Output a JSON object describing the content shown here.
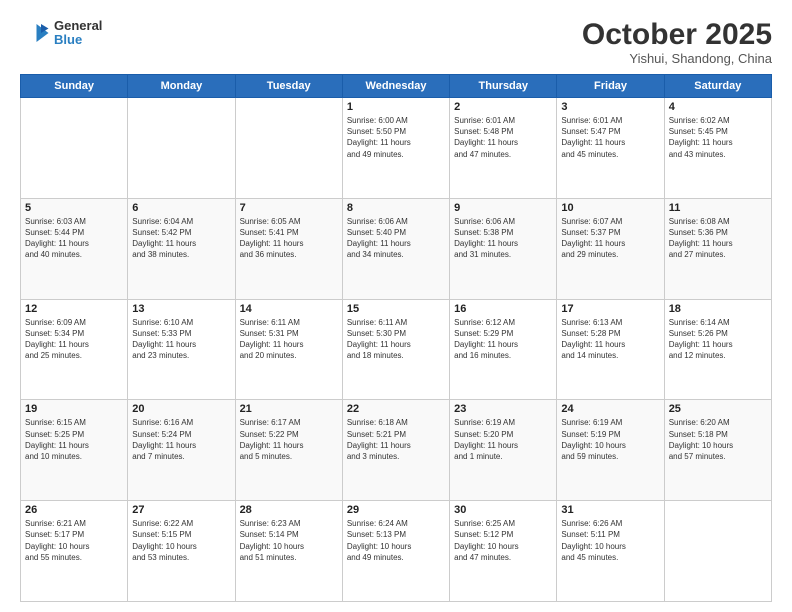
{
  "header": {
    "logo_line1": "General",
    "logo_line2": "Blue",
    "month": "October 2025",
    "location": "Yishui, Shandong, China"
  },
  "days_of_week": [
    "Sunday",
    "Monday",
    "Tuesday",
    "Wednesday",
    "Thursday",
    "Friday",
    "Saturday"
  ],
  "weeks": [
    [
      {
        "day": "",
        "info": ""
      },
      {
        "day": "",
        "info": ""
      },
      {
        "day": "",
        "info": ""
      },
      {
        "day": "1",
        "info": "Sunrise: 6:00 AM\nSunset: 5:50 PM\nDaylight: 11 hours\nand 49 minutes."
      },
      {
        "day": "2",
        "info": "Sunrise: 6:01 AM\nSunset: 5:48 PM\nDaylight: 11 hours\nand 47 minutes."
      },
      {
        "day": "3",
        "info": "Sunrise: 6:01 AM\nSunset: 5:47 PM\nDaylight: 11 hours\nand 45 minutes."
      },
      {
        "day": "4",
        "info": "Sunrise: 6:02 AM\nSunset: 5:45 PM\nDaylight: 11 hours\nand 43 minutes."
      }
    ],
    [
      {
        "day": "5",
        "info": "Sunrise: 6:03 AM\nSunset: 5:44 PM\nDaylight: 11 hours\nand 40 minutes."
      },
      {
        "day": "6",
        "info": "Sunrise: 6:04 AM\nSunset: 5:42 PM\nDaylight: 11 hours\nand 38 minutes."
      },
      {
        "day": "7",
        "info": "Sunrise: 6:05 AM\nSunset: 5:41 PM\nDaylight: 11 hours\nand 36 minutes."
      },
      {
        "day": "8",
        "info": "Sunrise: 6:06 AM\nSunset: 5:40 PM\nDaylight: 11 hours\nand 34 minutes."
      },
      {
        "day": "9",
        "info": "Sunrise: 6:06 AM\nSunset: 5:38 PM\nDaylight: 11 hours\nand 31 minutes."
      },
      {
        "day": "10",
        "info": "Sunrise: 6:07 AM\nSunset: 5:37 PM\nDaylight: 11 hours\nand 29 minutes."
      },
      {
        "day": "11",
        "info": "Sunrise: 6:08 AM\nSunset: 5:36 PM\nDaylight: 11 hours\nand 27 minutes."
      }
    ],
    [
      {
        "day": "12",
        "info": "Sunrise: 6:09 AM\nSunset: 5:34 PM\nDaylight: 11 hours\nand 25 minutes."
      },
      {
        "day": "13",
        "info": "Sunrise: 6:10 AM\nSunset: 5:33 PM\nDaylight: 11 hours\nand 23 minutes."
      },
      {
        "day": "14",
        "info": "Sunrise: 6:11 AM\nSunset: 5:31 PM\nDaylight: 11 hours\nand 20 minutes."
      },
      {
        "day": "15",
        "info": "Sunrise: 6:11 AM\nSunset: 5:30 PM\nDaylight: 11 hours\nand 18 minutes."
      },
      {
        "day": "16",
        "info": "Sunrise: 6:12 AM\nSunset: 5:29 PM\nDaylight: 11 hours\nand 16 minutes."
      },
      {
        "day": "17",
        "info": "Sunrise: 6:13 AM\nSunset: 5:28 PM\nDaylight: 11 hours\nand 14 minutes."
      },
      {
        "day": "18",
        "info": "Sunrise: 6:14 AM\nSunset: 5:26 PM\nDaylight: 11 hours\nand 12 minutes."
      }
    ],
    [
      {
        "day": "19",
        "info": "Sunrise: 6:15 AM\nSunset: 5:25 PM\nDaylight: 11 hours\nand 10 minutes."
      },
      {
        "day": "20",
        "info": "Sunrise: 6:16 AM\nSunset: 5:24 PM\nDaylight: 11 hours\nand 7 minutes."
      },
      {
        "day": "21",
        "info": "Sunrise: 6:17 AM\nSunset: 5:22 PM\nDaylight: 11 hours\nand 5 minutes."
      },
      {
        "day": "22",
        "info": "Sunrise: 6:18 AM\nSunset: 5:21 PM\nDaylight: 11 hours\nand 3 minutes."
      },
      {
        "day": "23",
        "info": "Sunrise: 6:19 AM\nSunset: 5:20 PM\nDaylight: 11 hours\nand 1 minute."
      },
      {
        "day": "24",
        "info": "Sunrise: 6:19 AM\nSunset: 5:19 PM\nDaylight: 10 hours\nand 59 minutes."
      },
      {
        "day": "25",
        "info": "Sunrise: 6:20 AM\nSunset: 5:18 PM\nDaylight: 10 hours\nand 57 minutes."
      }
    ],
    [
      {
        "day": "26",
        "info": "Sunrise: 6:21 AM\nSunset: 5:17 PM\nDaylight: 10 hours\nand 55 minutes."
      },
      {
        "day": "27",
        "info": "Sunrise: 6:22 AM\nSunset: 5:15 PM\nDaylight: 10 hours\nand 53 minutes."
      },
      {
        "day": "28",
        "info": "Sunrise: 6:23 AM\nSunset: 5:14 PM\nDaylight: 10 hours\nand 51 minutes."
      },
      {
        "day": "29",
        "info": "Sunrise: 6:24 AM\nSunset: 5:13 PM\nDaylight: 10 hours\nand 49 minutes."
      },
      {
        "day": "30",
        "info": "Sunrise: 6:25 AM\nSunset: 5:12 PM\nDaylight: 10 hours\nand 47 minutes."
      },
      {
        "day": "31",
        "info": "Sunrise: 6:26 AM\nSunset: 5:11 PM\nDaylight: 10 hours\nand 45 minutes."
      },
      {
        "day": "",
        "info": ""
      }
    ]
  ]
}
